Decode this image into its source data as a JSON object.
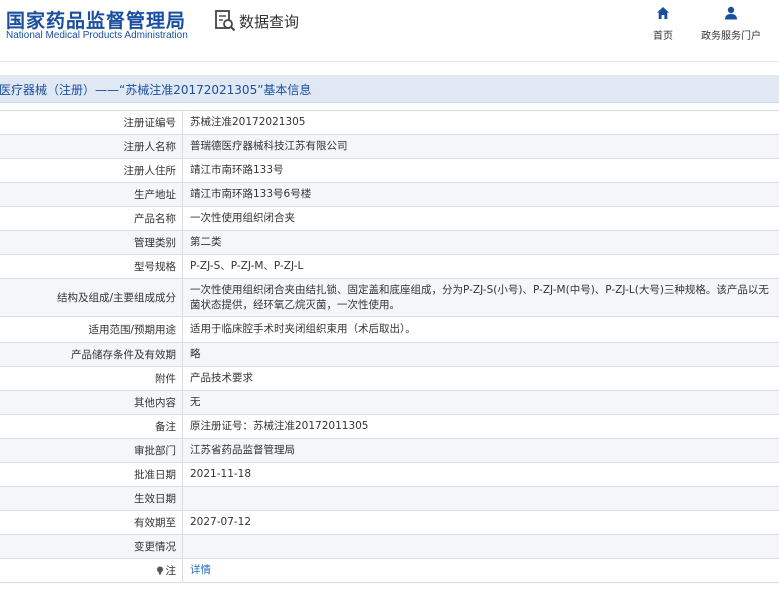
{
  "header": {
    "logo_cn": "国家药品监督管理局",
    "logo_en": "National Medical Products Administration",
    "query_label": "数据查询",
    "nav": {
      "home": "首页",
      "portal": "政务服务门户"
    }
  },
  "title": "医疗器械（注册）——“苏械注准20172021305”基本信息",
  "rows": [
    {
      "label": "注册证编号",
      "value": "苏械注准20172021305"
    },
    {
      "label": "注册人名称",
      "value": "普瑞德医疗器械科技江苏有限公司"
    },
    {
      "label": "注册人住所",
      "value": "靖江市南环路133号"
    },
    {
      "label": "生产地址",
      "value": "靖江市南环路133号6号楼"
    },
    {
      "label": "产品名称",
      "value": "一次性使用组织闭合夹"
    },
    {
      "label": "管理类别",
      "value": "第二类"
    },
    {
      "label": "型号规格",
      "value": "P-ZJ-S、P-ZJ-M、P-ZJ-L"
    },
    {
      "label": "结构及组成/主要组成成分",
      "value": "一次性使用组织闭合夹由结扎锁、固定盖和底座组成，分为P-ZJ-S(小号)、P-ZJ-M(中号)、P-ZJ-L(大号)三种规格。该产品以无菌状态提供，经环氧乙烷灭菌，一次性使用。"
    },
    {
      "label": "适用范围/预期用途",
      "value": "适用于临床腔手术时夹闭组织束用（术后取出）。"
    },
    {
      "label": "产品储存条件及有效期",
      "value": "略"
    },
    {
      "label": "附件",
      "value": "产品技术要求"
    },
    {
      "label": "其他内容",
      "value": "无"
    },
    {
      "label": "备注",
      "value": "原注册证号：苏械注准20172011305"
    },
    {
      "label": "审批部门",
      "value": "江苏省药品监督管理局"
    },
    {
      "label": "批准日期",
      "value": "2021-11-18"
    },
    {
      "label": "生效日期",
      "value": ""
    },
    {
      "label": "有效期至",
      "value": "2027-07-12"
    },
    {
      "label": "变更情况",
      "value": ""
    },
    {
      "label": "注",
      "value": "详情"
    }
  ],
  "colors": {
    "brand": "#1a4fa0",
    "title_bg": "#dfe8f3",
    "link": "#2a6dc4",
    "border": "#d9dee5"
  },
  "icons": {
    "query": "search-document-icon",
    "home": "home-icon",
    "portal": "user-icon",
    "note": "lightbulb-icon"
  }
}
